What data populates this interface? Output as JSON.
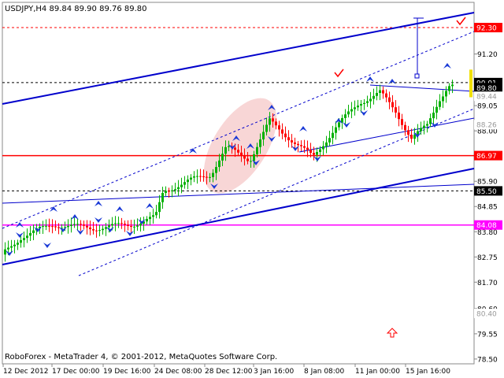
{
  "chart_data": {
    "type": "candlestick",
    "header": "USDJPY,H4  89.84 89.90 89.76 89.80",
    "watermark": "RoboForex - MetaTrader 4, © 2001-2012, MetaQuotes Software Corp.",
    "y_ticks": [
      78.5,
      79.55,
      80.6,
      81.7,
      82.75,
      83.8,
      84.85,
      85.9,
      88.0,
      89.05,
      91.2
    ],
    "y_tick_labels": [
      "78.50",
      "79.55",
      "80.60",
      "81.70",
      "82.75",
      "83.80",
      "84.85",
      "85.90",
      "88.00",
      "89.05",
      "91.20"
    ],
    "x_tick_labels": [
      "12 Dec 2012",
      "17 Dec 00:00",
      "19 Dec 16:00",
      "24 Dec 08:00",
      "28 Dec 12:00",
      "3 Jan 16:00",
      "8 Jan 08:00",
      "11 Jan 00:00",
      "15 Jan 16:00"
    ],
    "ylim": [
      78.3,
      93.35
    ],
    "levels": [
      {
        "value": 92.3,
        "label": "92.30",
        "color": "#ff0000",
        "style": "dashed"
      },
      {
        "value": 90.01,
        "label": "90.01",
        "color": "#000000",
        "style": "dashed"
      },
      {
        "value": 89.8,
        "label": "89.80",
        "color": "#000000",
        "style": "none"
      },
      {
        "value": 89.44,
        "label": "89.44",
        "color": "#bbbbbb",
        "style": "none"
      },
      {
        "value": 88.26,
        "label": "88.26",
        "color": "#bbbbbb",
        "style": "none"
      },
      {
        "value": 86.97,
        "label": "86.97",
        "color": "#ff0000",
        "style": "solid"
      },
      {
        "value": 85.5,
        "label": "85.50",
        "color": "#000000",
        "style": "dashed"
      },
      {
        "value": 84.08,
        "label": "84.08",
        "color": "#ff00ff",
        "style": "solid"
      },
      {
        "value": 80.4,
        "label": "80.40",
        "color": "#bbbbbb",
        "style": "none"
      }
    ],
    "colors": {
      "bull": "#00b000",
      "bear": "#ff0000",
      "channel": "#0000cc",
      "arrow": "#1a3ad6",
      "highlight": "#f5c8c8",
      "current_price_box": "#000000",
      "target_marker": "#f0e000"
    }
  }
}
